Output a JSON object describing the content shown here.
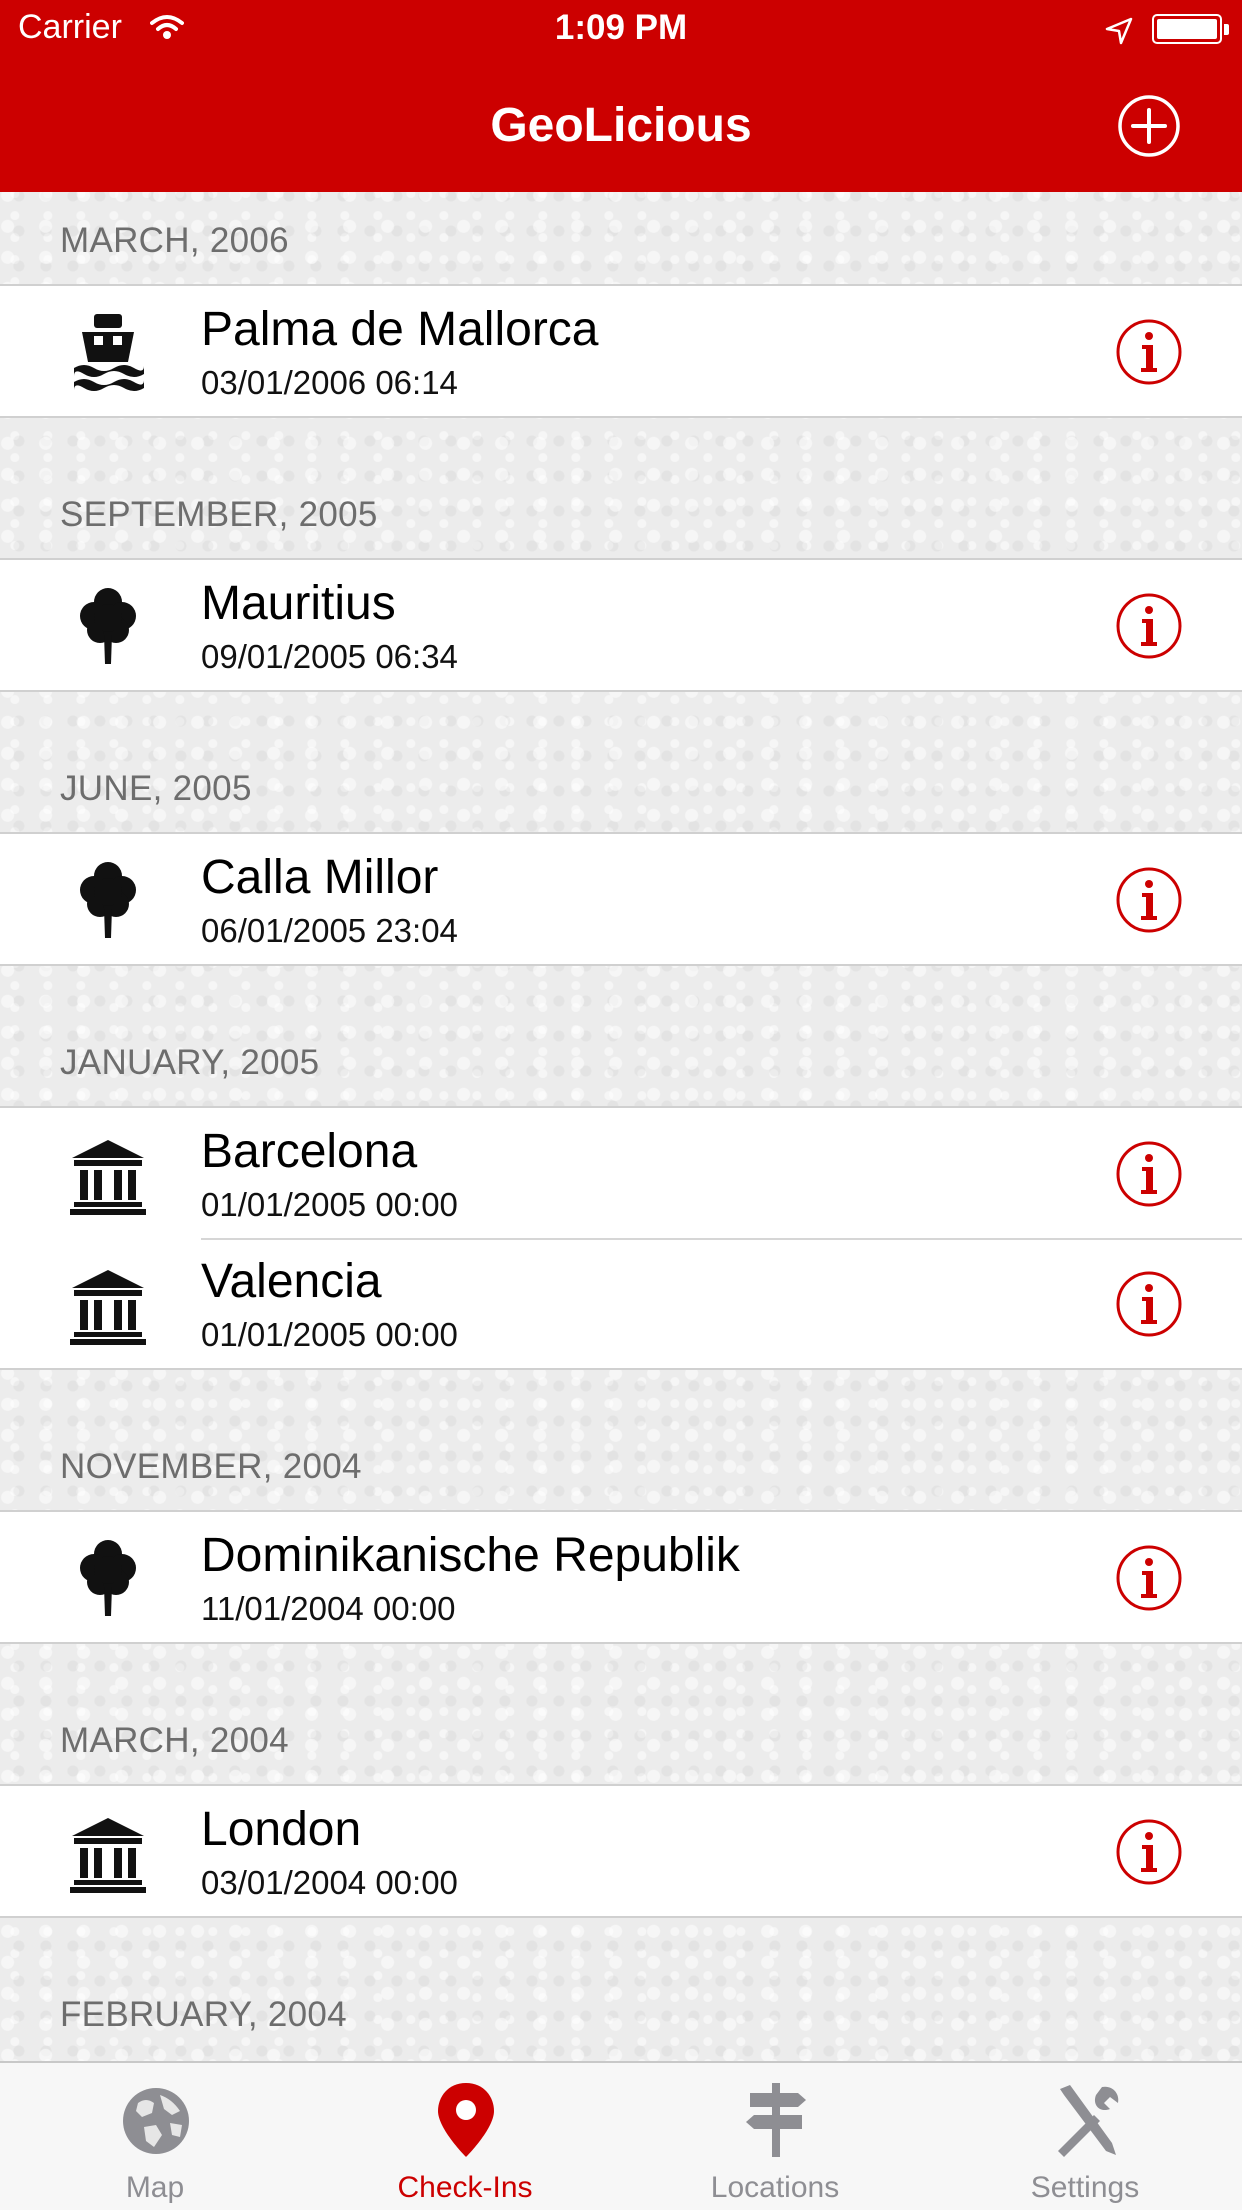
{
  "status_bar": {
    "carrier": "Carrier",
    "time": "1:09 PM"
  },
  "nav": {
    "title": "GeoLicious",
    "add_icon": "plus-circle-icon"
  },
  "sections": [
    {
      "header": "MARCH, 2006",
      "items": [
        {
          "title": "Palma de Mallorca",
          "date": "03/01/2006 06:14",
          "icon": "ship-icon"
        }
      ]
    },
    {
      "header": "SEPTEMBER, 2005",
      "items": [
        {
          "title": "Mauritius",
          "date": "09/01/2005 06:34",
          "icon": "tree-icon"
        }
      ]
    },
    {
      "header": "JUNE, 2005",
      "items": [
        {
          "title": "Calla Millor",
          "date": "06/01/2005 23:04",
          "icon": "tree-icon"
        }
      ]
    },
    {
      "header": "JANUARY, 2005",
      "items": [
        {
          "title": "Barcelona",
          "date": "01/01/2005 00:00",
          "icon": "museum-icon"
        },
        {
          "title": "Valencia",
          "date": "01/01/2005 00:00",
          "icon": "museum-icon"
        }
      ]
    },
    {
      "header": "NOVEMBER, 2004",
      "items": [
        {
          "title": "Dominikanische Republik",
          "date": "11/01/2004 00:00",
          "icon": "tree-icon"
        }
      ]
    },
    {
      "header": "MARCH, 2004",
      "items": [
        {
          "title": "London",
          "date": "03/01/2004 00:00",
          "icon": "museum-icon"
        }
      ]
    },
    {
      "header": "FEBRUARY, 2004",
      "items": []
    }
  ],
  "tabs": [
    {
      "label": "Map",
      "icon": "globe-icon",
      "active": false
    },
    {
      "label": "Check-Ins",
      "icon": "map-pin-icon",
      "active": true
    },
    {
      "label": "Locations",
      "icon": "signpost-icon",
      "active": false
    },
    {
      "label": "Settings",
      "icon": "tools-icon",
      "active": false
    }
  ],
  "colors": {
    "brand_red": "#cc0000",
    "tab_inactive": "#8e8e93",
    "section_text": "#6d6d6d"
  }
}
